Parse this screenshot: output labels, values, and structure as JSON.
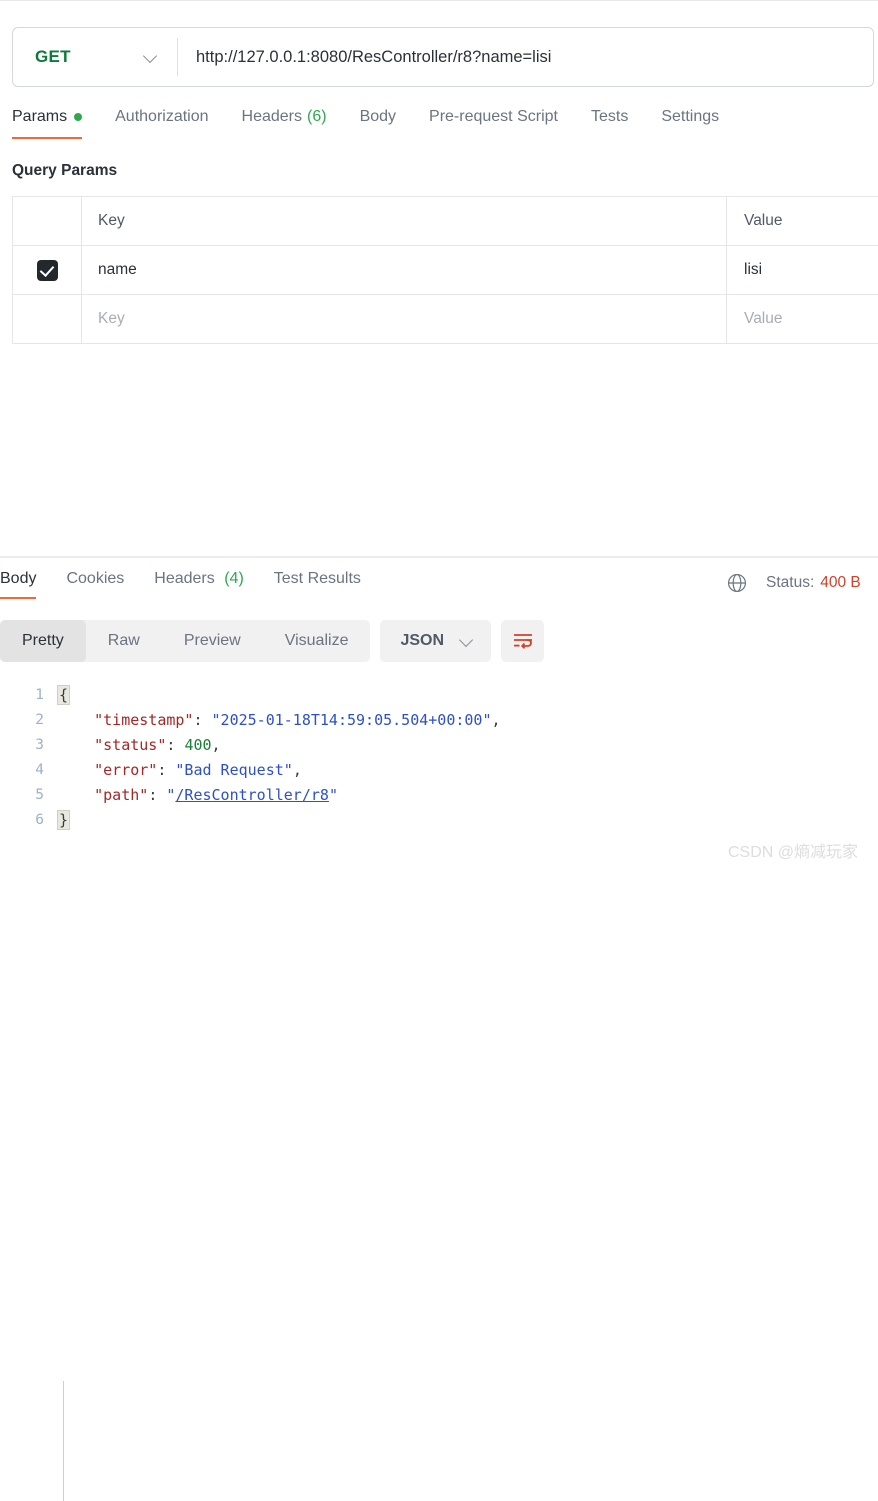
{
  "request": {
    "method": "GET",
    "url": "http://127.0.0.1:8080/ResController/r8?name=lisi",
    "tabs": [
      {
        "label": "Params",
        "active": true,
        "dot": true
      },
      {
        "label": "Authorization",
        "active": false
      },
      {
        "label": "Headers",
        "count": "(6)",
        "active": false
      },
      {
        "label": "Body",
        "active": false
      },
      {
        "label": "Pre-request Script",
        "active": false
      },
      {
        "label": "Tests",
        "active": false
      },
      {
        "label": "Settings",
        "active": false
      }
    ],
    "query_params": {
      "section_title": "Query Params",
      "headers": {
        "key": "Key",
        "value": "Value"
      },
      "rows": [
        {
          "checked": true,
          "key": "name",
          "value": "lisi"
        },
        {
          "checked": false,
          "key_placeholder": "Key",
          "value_placeholder": "Value"
        }
      ]
    }
  },
  "response": {
    "tabs": [
      {
        "label": "Body",
        "active": true
      },
      {
        "label": "Cookies",
        "active": false
      },
      {
        "label": "Headers",
        "count": "(4)",
        "active": false
      },
      {
        "label": "Test Results",
        "active": false
      }
    ],
    "status_label": "Status:",
    "status_value": "400 B",
    "view_modes": [
      {
        "label": "Pretty",
        "active": true
      },
      {
        "label": "Raw",
        "active": false
      },
      {
        "label": "Preview",
        "active": false
      },
      {
        "label": "Visualize",
        "active": false
      }
    ],
    "format": "JSON",
    "body_lines": [
      {
        "num": "1",
        "type": "brace-open",
        "text": "{"
      },
      {
        "num": "2",
        "type": "kv-string",
        "key": "\"timestamp\"",
        "sep": ": ",
        "value": "\"2025-01-18T14:59:05.504+00:00\"",
        "tail": ","
      },
      {
        "num": "3",
        "type": "kv-number",
        "key": "\"status\"",
        "sep": ": ",
        "value": "400",
        "tail": ","
      },
      {
        "num": "4",
        "type": "kv-string",
        "key": "\"error\"",
        "sep": ": ",
        "value": "\"Bad Request\"",
        "tail": ","
      },
      {
        "num": "5",
        "type": "kv-link",
        "key": "\"path\"",
        "sep": ": ",
        "quote": "\"",
        "link": "/ResController/r8",
        "tail": ""
      },
      {
        "num": "6",
        "type": "brace-close",
        "text": "}"
      }
    ]
  },
  "watermark": "CSDN @熵减玩家",
  "colors": {
    "accent_orange": "#f2663c",
    "method_green": "#0d7a3d",
    "count_green": "#2fa84f",
    "status_red": "#d2412a",
    "json_key": "#a52727",
    "json_string": "#2d50c8",
    "json_number": "#1a7f37"
  }
}
